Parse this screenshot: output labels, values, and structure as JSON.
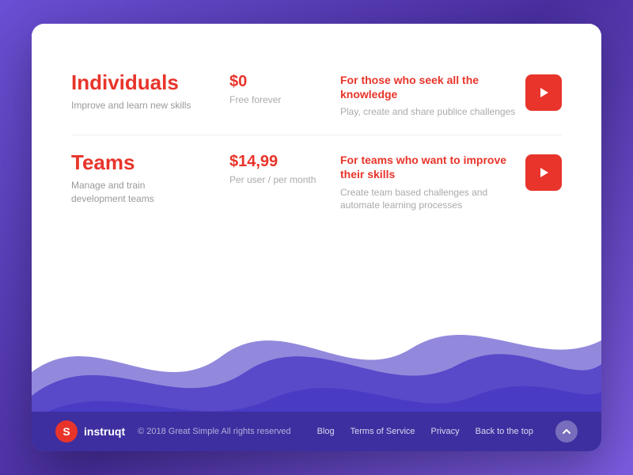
{
  "background": "#5b3db5",
  "plans": [
    {
      "id": "individuals",
      "title": "Individuals",
      "subtitle": "Improve and learn new skills",
      "price": "$0",
      "price_sub": "Free forever",
      "desc_title": "For those who seek all the knowledge",
      "desc_sub": "Play, create and share publice challenges",
      "btn_label": "Play"
    },
    {
      "id": "teams",
      "title": "Teams",
      "subtitle": "Manage and train\ndevelopment teams",
      "price": "$14,99",
      "price_sub": "Per user / per month",
      "desc_title": "For teams who want to improve their skills",
      "desc_sub": "Create team based challenges and automate learning processes",
      "btn_label": "Play"
    }
  ],
  "footer": {
    "logo_text": "instruqt",
    "copyright": "© 2018 Great Simple All rights reserved",
    "links": [
      "Blog",
      "Terms of Service",
      "Privacy",
      "Back to the top"
    ]
  }
}
